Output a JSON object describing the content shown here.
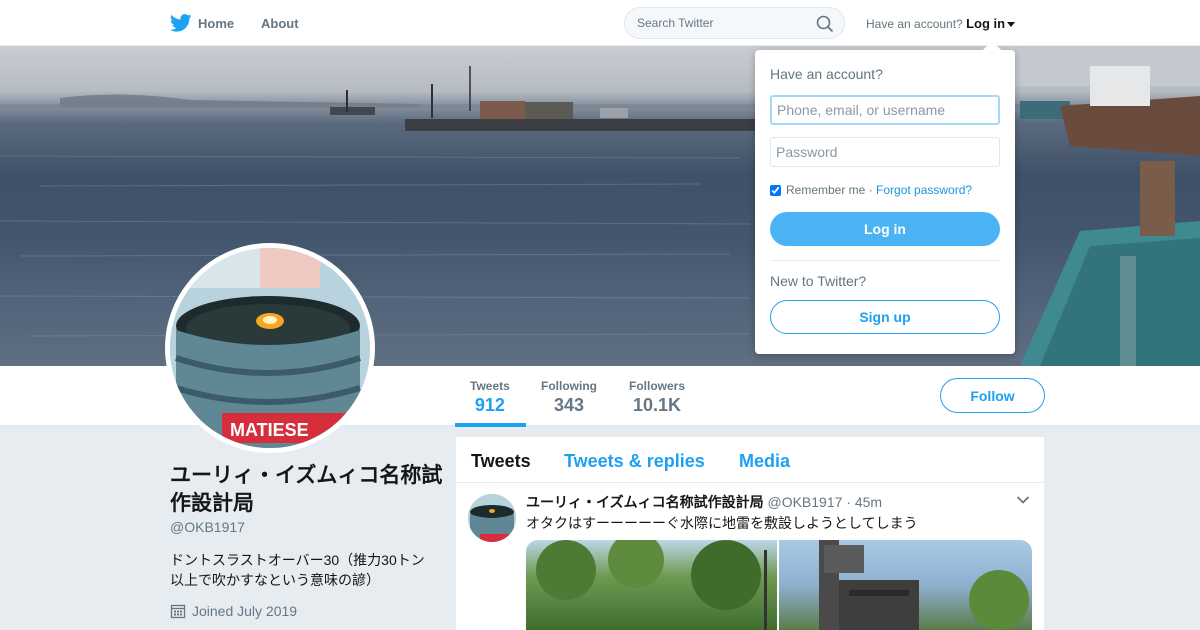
{
  "nav": {
    "home_label": "Home",
    "about_label": "About",
    "search_placeholder": "Search Twitter",
    "account_prompt": "Have an account?",
    "login_label": "Log in"
  },
  "profile": {
    "name": "ユーリィ・イズムィコ名称試作設計局",
    "handle": "@OKB1917",
    "bio": "ドントスラストオーバー30（推力30トン以上で吹かすなという意味の諺）",
    "joined": "Joined July 2019",
    "avatar_text": "MATIESE",
    "follow_label": "Follow"
  },
  "stats": [
    {
      "label": "Tweets",
      "value": "912",
      "active": true
    },
    {
      "label": "Following",
      "value": "343",
      "active": false
    },
    {
      "label": "Followers",
      "value": "10.1K",
      "active": false
    }
  ],
  "timeline": {
    "tabs": [
      {
        "label": "Tweets",
        "active": true
      },
      {
        "label": "Tweets & replies",
        "active": false
      },
      {
        "label": "Media",
        "active": false
      }
    ]
  },
  "tweet": {
    "name": "ユーリィ・イズムィコ名称試作設計局",
    "handle": "@OKB1917",
    "time": "· 45m",
    "text": "オタクはすーーーーーぐ水際に地雷を敷設しようとしてしまう"
  },
  "login_dropdown": {
    "title": "Have an account?",
    "username_placeholder": "Phone, email, or username",
    "password_placeholder": "Password",
    "remember_label": "Remember me",
    "forgot_label": "Forgot password?",
    "login_button": "Log in",
    "new_prompt": "New to Twitter?",
    "signup_button": "Sign up"
  },
  "colors": {
    "accent": "#1da1f2",
    "login_button": "#4ab3f4"
  }
}
